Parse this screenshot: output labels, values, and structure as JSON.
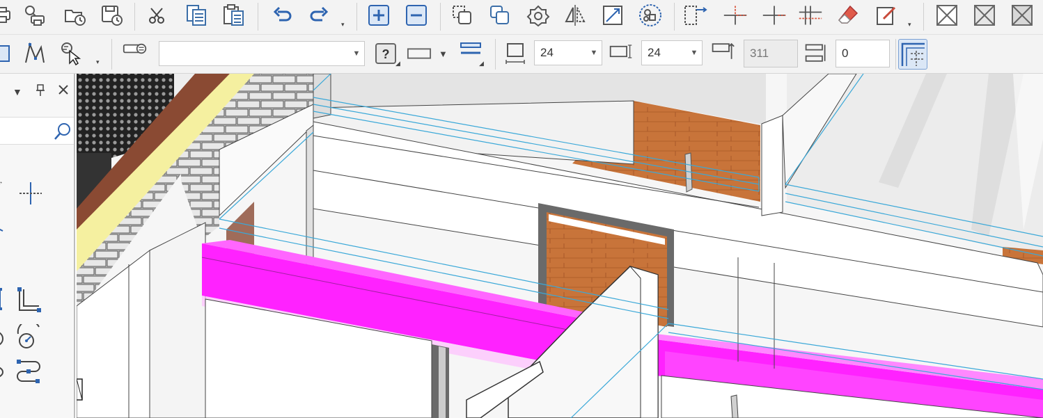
{
  "toolbar_row1": {
    "icons": [
      "print-icon",
      "print-preview-icon",
      "open-recent-icon",
      "save-recent-icon",
      "cut-icon",
      "copy-icon",
      "paste-icon",
      "undo-icon",
      "redo-icon",
      "plus-icon",
      "minus-icon",
      "copy-object-icon",
      "duplicate-icon",
      "rotate-icon",
      "mirror-icon",
      "scale-icon",
      "group-icon",
      "align-icon",
      "trim-icon",
      "extend-icon",
      "offset-icon",
      "eraser-icon",
      "edit-icon",
      "view-cross-1-icon",
      "view-cross-2-icon",
      "view-cross-3-icon"
    ]
  },
  "toolbar_row2": {
    "layer_combo": {
      "value": ""
    },
    "text_height_combo": {
      "value": "24"
    },
    "text_width_combo": {
      "value": "24"
    },
    "elevation_field": {
      "value": "311"
    },
    "offset_field": {
      "value": "0"
    },
    "help_label": "?"
  },
  "panel": {
    "icons": [
      "dropdown-icon",
      "pin-icon",
      "close-icon",
      "search-icon",
      "crosshair-icon",
      "angle-icon",
      "arc-icon",
      "spline-icon"
    ]
  },
  "viewport": {
    "description_colors": {
      "highlight": "#ff22ff",
      "wood": "#c8743a",
      "wire": "#3aa8d8",
      "brick": "#8a4a33",
      "insulation": "#f5f0a0"
    }
  }
}
